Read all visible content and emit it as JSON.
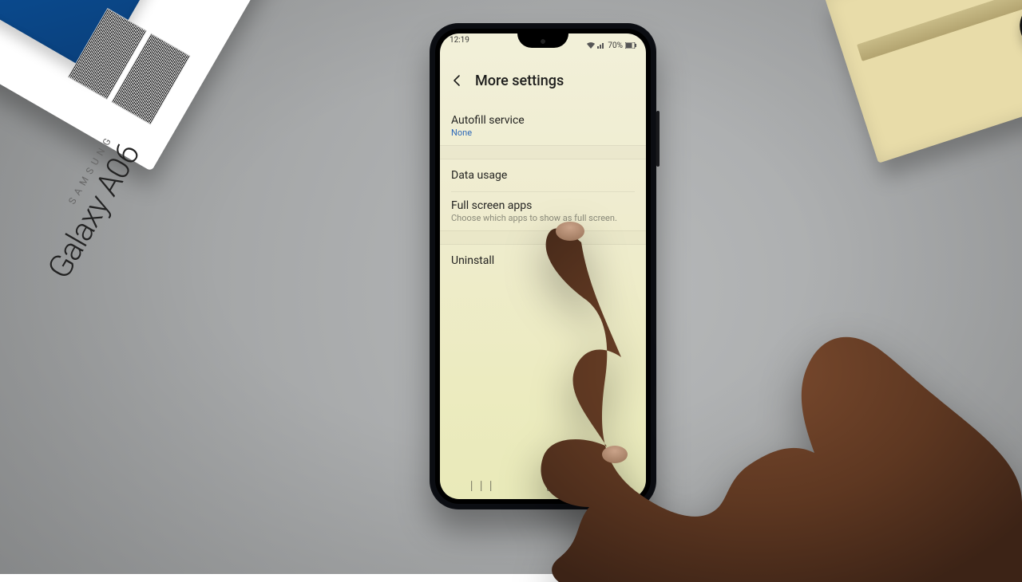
{
  "scene": {
    "box_brand": "Galaxy A06",
    "box_sub": "SAMSUNG"
  },
  "phone": {
    "status": {
      "time": "12:19",
      "battery": "70%"
    },
    "header": {
      "title": "More settings"
    },
    "rows": {
      "autofill": {
        "title": "Autofill service",
        "sub": "None"
      },
      "data_usage": {
        "title": "Data usage"
      },
      "full_screen": {
        "title": "Full screen apps",
        "sub": "Choose which apps to show as full screen."
      },
      "uninstall": {
        "title": "Uninstall"
      }
    },
    "nav": {
      "recents": "|||",
      "home": "◯",
      "back": "<"
    }
  }
}
